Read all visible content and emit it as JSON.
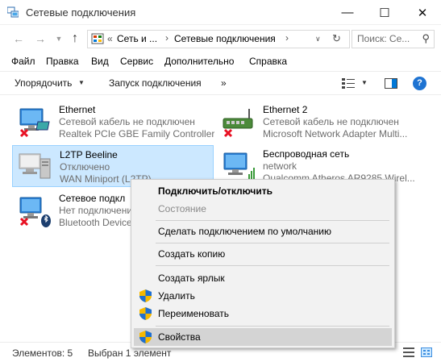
{
  "window": {
    "title": "Сетевые подключения"
  },
  "address": {
    "segments": [
      "«",
      "Сеть и ...",
      "›",
      "Сетевые подключения",
      "›"
    ],
    "search_placeholder": "Поиск: Се..."
  },
  "menu": [
    "Файл",
    "Правка",
    "Вид",
    "Сервис",
    "Дополнительно",
    "Справка"
  ],
  "commands": {
    "organize": "Упорядочить",
    "start": "Запуск подключения",
    "more": "»"
  },
  "connections": [
    {
      "name": "Ethernet",
      "status": "Сетевой кабель не подключен",
      "device": "Realtek PCIe GBE Family Controller"
    },
    {
      "name": "Ethernet 2",
      "status": "Сетевой кабель не подключен",
      "device": "Microsoft Network Adapter Multi..."
    },
    {
      "name": "L2TP Beeline",
      "status": "Отключено",
      "device": "WAN Miniport (L2TP)"
    },
    {
      "name": "Беспроводная сеть",
      "status": "network",
      "device": "Qualcomm Atheros AR9285 Wirel..."
    },
    {
      "name": "Сетевое подкл",
      "status": "Нет подключения",
      "device": "Bluetooth Device"
    }
  ],
  "context_menu": {
    "items": [
      "Подключить/отключить",
      "Состояние",
      "Сделать подключением по умолчанию",
      "Создать копию",
      "Создать ярлык",
      "Удалить",
      "Переименовать",
      "Свойства"
    ]
  },
  "status": {
    "count": "Элементов: 5",
    "selected": "Выбран 1 элемент"
  },
  "colors": {
    "selection": "#cce8ff",
    "accent": "#1e73d2",
    "error": "#e81123"
  }
}
